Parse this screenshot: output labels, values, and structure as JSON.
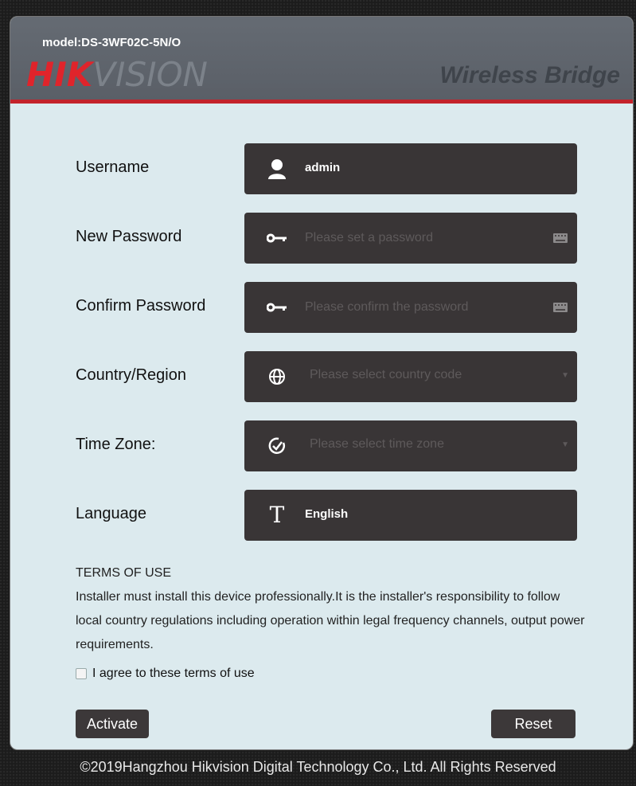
{
  "header": {
    "model": "model:DS-3WF02C-5N/O",
    "logo_part1": "HIK",
    "logo_part2": "VISION",
    "product": "Wireless Bridge"
  },
  "form": {
    "username": {
      "label": "Username",
      "value": "admin"
    },
    "new_password": {
      "label": "New Password",
      "placeholder": "Please set a password"
    },
    "confirm_password": {
      "label": "Confirm Password",
      "placeholder": "Please confirm the password"
    },
    "country": {
      "label": "Country/Region",
      "placeholder": "Please select country code"
    },
    "timezone": {
      "label": "Time Zone:",
      "placeholder": "Please select time zone"
    },
    "language": {
      "label": "Language",
      "value": "English"
    }
  },
  "terms": {
    "title": "TERMS OF USE",
    "body": "Installer must install this device professionally.It is the installer's responsibility to follow local country regulations including operation within legal frequency channels, output power requirements.",
    "agree_label": "I agree to these terms of use"
  },
  "buttons": {
    "activate": "Activate",
    "reset": "Reset"
  },
  "footer": "©2019Hangzhou Hikvision Digital Technology Co., Ltd. All Rights Reserved",
  "colors": {
    "accent": "#c3232b",
    "field_bg": "#393536",
    "panel_bg": "#dceaee",
    "header_bg": "#5f646c"
  },
  "icons": {
    "username": "user-icon",
    "password": "key-icon",
    "keyboard": "keyboard-icon",
    "country": "globe-icon",
    "timezone": "clock-check-icon",
    "language": "text-t-icon"
  }
}
